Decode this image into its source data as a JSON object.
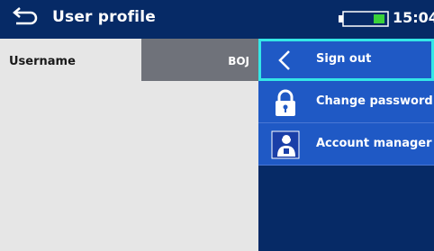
{
  "header": {
    "title": "User profile",
    "time": "15:04",
    "back_icon": "back-arrow-icon",
    "battery_icon": "battery-icon"
  },
  "profile": {
    "username_label": "Username",
    "username_value": "BOJ"
  },
  "menu": {
    "items": [
      {
        "label": "Sign out",
        "icon": "chevron-left-icon",
        "selected": true
      },
      {
        "label": "Change password",
        "icon": "lock-icon",
        "selected": false
      },
      {
        "label": "Account manager",
        "icon": "account-manager-icon",
        "selected": false
      }
    ]
  },
  "colors": {
    "header_bg": "#062a66",
    "menu_item_bg": "#1f59c5",
    "selection_border": "#34e7e7",
    "content_bg": "#e6e6e6"
  }
}
